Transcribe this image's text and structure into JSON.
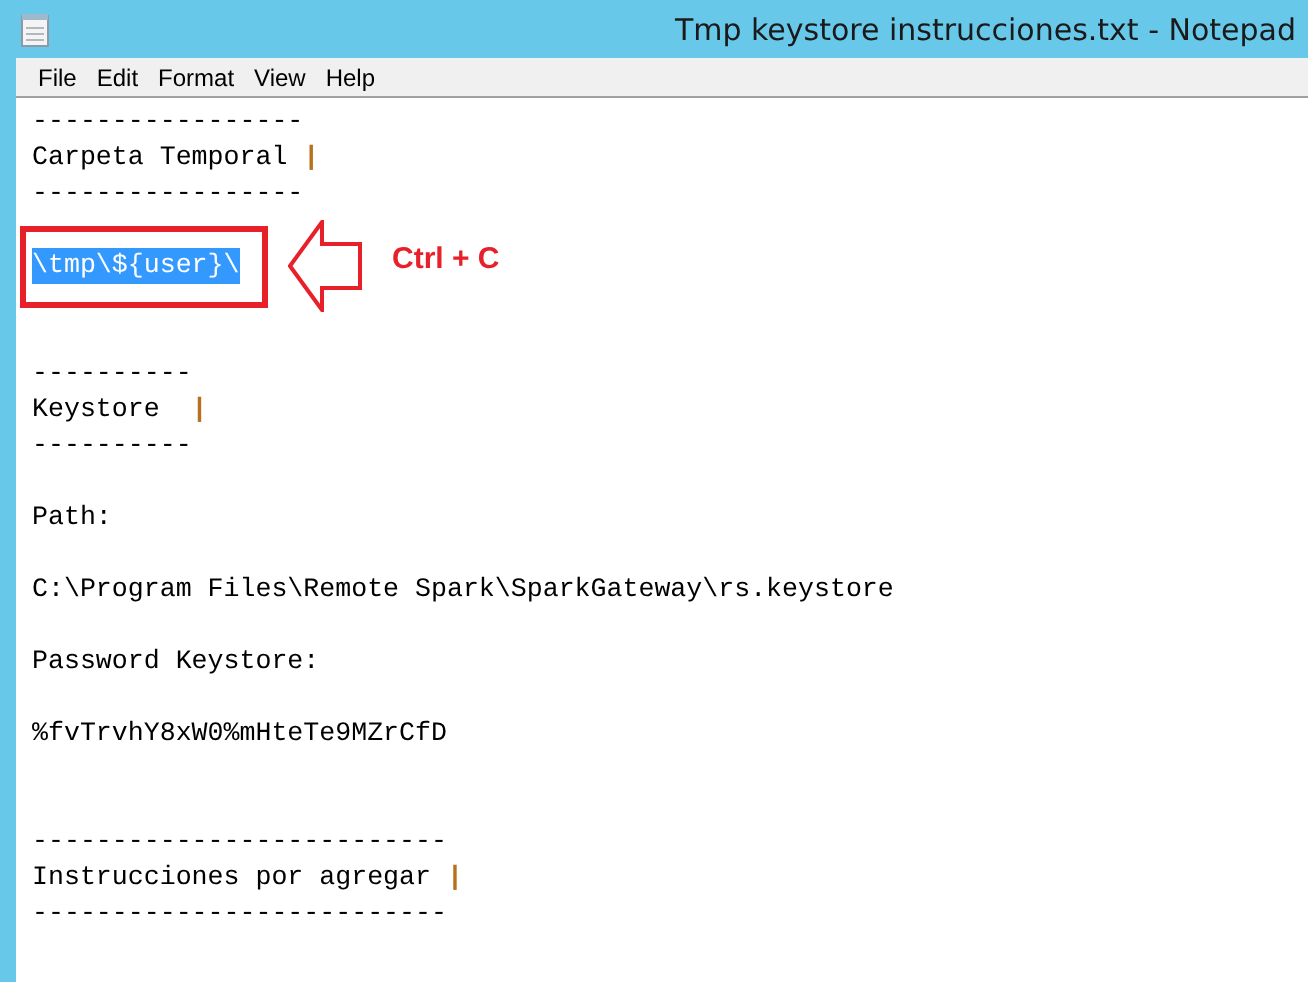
{
  "window": {
    "title": "Tmp keystore instrucciones.txt - Notepad"
  },
  "menu": [
    "File",
    "Edit",
    "Format",
    "View",
    "Help"
  ],
  "lines": [
    {
      "kind": "text",
      "text": "-----------------",
      "selected": false
    },
    {
      "kind": "heading",
      "text": "Carpeta Temporal ",
      "marker": "|"
    },
    {
      "kind": "text",
      "text": "-----------------",
      "selected": false
    },
    {
      "kind": "blank"
    },
    {
      "kind": "text",
      "text": "\\tmp\\${user}\\",
      "selected": true
    },
    {
      "kind": "blank"
    },
    {
      "kind": "blank"
    },
    {
      "kind": "text",
      "text": "----------",
      "selected": false
    },
    {
      "kind": "heading",
      "text": "Keystore  ",
      "marker": "|"
    },
    {
      "kind": "text",
      "text": "----------",
      "selected": false
    },
    {
      "kind": "blank"
    },
    {
      "kind": "text",
      "text": "Path:",
      "selected": false
    },
    {
      "kind": "blank"
    },
    {
      "kind": "text",
      "text": "C:\\Program Files\\Remote Spark\\SparkGateway\\rs.keystore",
      "selected": false
    },
    {
      "kind": "blank"
    },
    {
      "kind": "text",
      "text": "Password Keystore:",
      "selected": false
    },
    {
      "kind": "blank"
    },
    {
      "kind": "text",
      "text": "%fvTrvhY8xW0%mHteTe9MZrCfD",
      "selected": false
    },
    {
      "kind": "blank"
    },
    {
      "kind": "blank"
    },
    {
      "kind": "text",
      "text": "--------------------------",
      "selected": false
    },
    {
      "kind": "heading",
      "text": "Instrucciones por agregar ",
      "marker": "|"
    },
    {
      "kind": "text",
      "text": "--------------------------",
      "selected": false
    }
  ],
  "annotation": {
    "label": "Ctrl + C"
  }
}
